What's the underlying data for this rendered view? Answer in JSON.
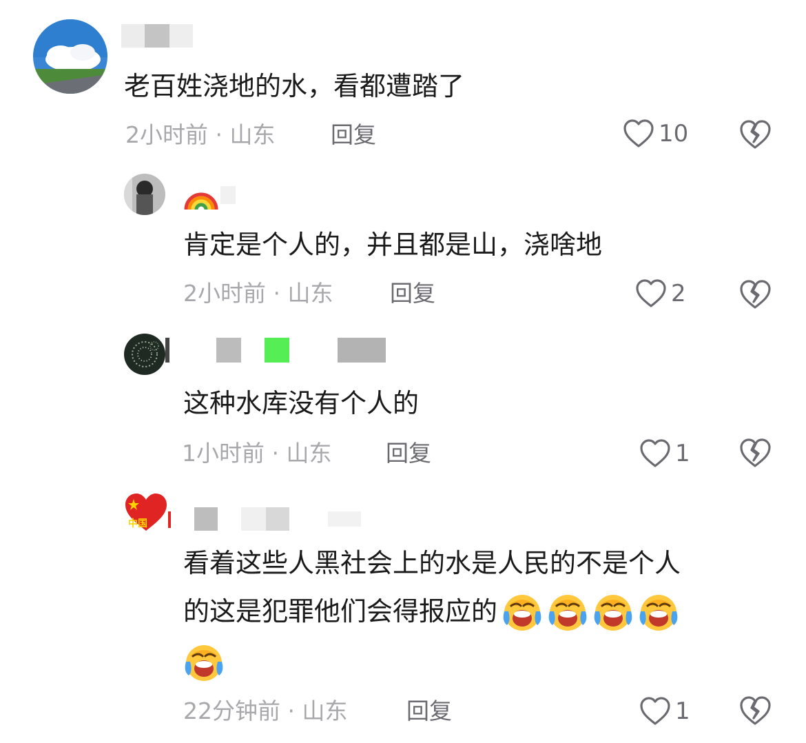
{
  "comments": [
    {
      "text_lines": [
        "老百姓浇地的水，看都遭踏了"
      ],
      "meta": "2小时前 · 山东",
      "reply_label": "回复",
      "likes": "10",
      "avatar": "cloud-sky-avatar"
    },
    {
      "username_prefix": "🌈",
      "text_lines": [
        "肯定是个人的，并且都是山，浇啥地"
      ],
      "meta": "2小时前 · 山东",
      "reply_label": "回复",
      "likes": "2",
      "avatar": "dark-portrait-avatar"
    },
    {
      "text_lines": [
        "这种水库没有个人的"
      ],
      "meta": "1小时前 · 山东",
      "reply_label": "回复",
      "likes": "1",
      "avatar": "fireworks-avatar"
    },
    {
      "text_lines": [
        "看着这些人黑社会上的水是人民的不是个人",
        "的这是犯罪他们会得报应的"
      ],
      "emoji_name": "crying-laughing-emoji",
      "emoji_count": 5,
      "meta": "22分钟前 · 山东",
      "reply_label": "回复",
      "likes": "1",
      "avatar": "china-heart-avatar",
      "avatar_text": "中国"
    }
  ],
  "icons": {
    "like": "heart-outline-icon",
    "dislike": "broken-heart-icon"
  },
  "colors": {
    "meta_gray": "#a8a8ac",
    "action_gray": "#6a6a70",
    "text": "#1a1a1a",
    "redacted_green": "#55ee55"
  }
}
